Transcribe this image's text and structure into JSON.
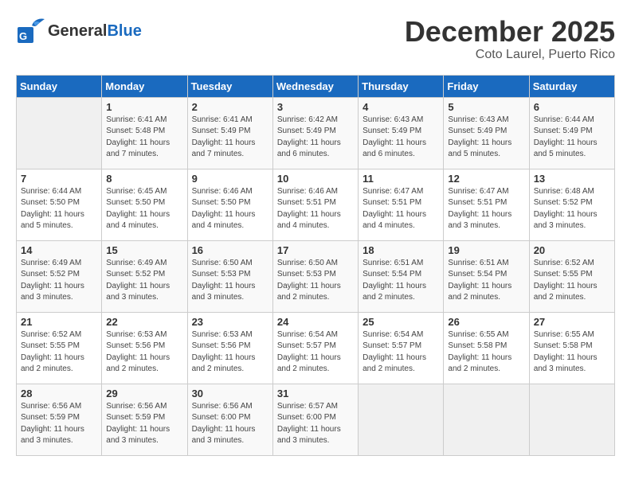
{
  "header": {
    "logo_general": "General",
    "logo_blue": "Blue",
    "month_title": "December 2025",
    "location": "Coto Laurel, Puerto Rico"
  },
  "days_of_week": [
    "Sunday",
    "Monday",
    "Tuesday",
    "Wednesday",
    "Thursday",
    "Friday",
    "Saturday"
  ],
  "weeks": [
    [
      {
        "day": "",
        "sunrise": "",
        "sunset": "",
        "daylight": ""
      },
      {
        "day": "1",
        "sunrise": "Sunrise: 6:41 AM",
        "sunset": "Sunset: 5:48 PM",
        "daylight": "Daylight: 11 hours and 7 minutes."
      },
      {
        "day": "2",
        "sunrise": "Sunrise: 6:41 AM",
        "sunset": "Sunset: 5:49 PM",
        "daylight": "Daylight: 11 hours and 7 minutes."
      },
      {
        "day": "3",
        "sunrise": "Sunrise: 6:42 AM",
        "sunset": "Sunset: 5:49 PM",
        "daylight": "Daylight: 11 hours and 6 minutes."
      },
      {
        "day": "4",
        "sunrise": "Sunrise: 6:43 AM",
        "sunset": "Sunset: 5:49 PM",
        "daylight": "Daylight: 11 hours and 6 minutes."
      },
      {
        "day": "5",
        "sunrise": "Sunrise: 6:43 AM",
        "sunset": "Sunset: 5:49 PM",
        "daylight": "Daylight: 11 hours and 5 minutes."
      },
      {
        "day": "6",
        "sunrise": "Sunrise: 6:44 AM",
        "sunset": "Sunset: 5:49 PM",
        "daylight": "Daylight: 11 hours and 5 minutes."
      }
    ],
    [
      {
        "day": "7",
        "sunrise": "Sunrise: 6:44 AM",
        "sunset": "Sunset: 5:50 PM",
        "daylight": "Daylight: 11 hours and 5 minutes."
      },
      {
        "day": "8",
        "sunrise": "Sunrise: 6:45 AM",
        "sunset": "Sunset: 5:50 PM",
        "daylight": "Daylight: 11 hours and 4 minutes."
      },
      {
        "day": "9",
        "sunrise": "Sunrise: 6:46 AM",
        "sunset": "Sunset: 5:50 PM",
        "daylight": "Daylight: 11 hours and 4 minutes."
      },
      {
        "day": "10",
        "sunrise": "Sunrise: 6:46 AM",
        "sunset": "Sunset: 5:51 PM",
        "daylight": "Daylight: 11 hours and 4 minutes."
      },
      {
        "day": "11",
        "sunrise": "Sunrise: 6:47 AM",
        "sunset": "Sunset: 5:51 PM",
        "daylight": "Daylight: 11 hours and 4 minutes."
      },
      {
        "day": "12",
        "sunrise": "Sunrise: 6:47 AM",
        "sunset": "Sunset: 5:51 PM",
        "daylight": "Daylight: 11 hours and 3 minutes."
      },
      {
        "day": "13",
        "sunrise": "Sunrise: 6:48 AM",
        "sunset": "Sunset: 5:52 PM",
        "daylight": "Daylight: 11 hours and 3 minutes."
      }
    ],
    [
      {
        "day": "14",
        "sunrise": "Sunrise: 6:49 AM",
        "sunset": "Sunset: 5:52 PM",
        "daylight": "Daylight: 11 hours and 3 minutes."
      },
      {
        "day": "15",
        "sunrise": "Sunrise: 6:49 AM",
        "sunset": "Sunset: 5:52 PM",
        "daylight": "Daylight: 11 hours and 3 minutes."
      },
      {
        "day": "16",
        "sunrise": "Sunrise: 6:50 AM",
        "sunset": "Sunset: 5:53 PM",
        "daylight": "Daylight: 11 hours and 3 minutes."
      },
      {
        "day": "17",
        "sunrise": "Sunrise: 6:50 AM",
        "sunset": "Sunset: 5:53 PM",
        "daylight": "Daylight: 11 hours and 2 minutes."
      },
      {
        "day": "18",
        "sunrise": "Sunrise: 6:51 AM",
        "sunset": "Sunset: 5:54 PM",
        "daylight": "Daylight: 11 hours and 2 minutes."
      },
      {
        "day": "19",
        "sunrise": "Sunrise: 6:51 AM",
        "sunset": "Sunset: 5:54 PM",
        "daylight": "Daylight: 11 hours and 2 minutes."
      },
      {
        "day": "20",
        "sunrise": "Sunrise: 6:52 AM",
        "sunset": "Sunset: 5:55 PM",
        "daylight": "Daylight: 11 hours and 2 minutes."
      }
    ],
    [
      {
        "day": "21",
        "sunrise": "Sunrise: 6:52 AM",
        "sunset": "Sunset: 5:55 PM",
        "daylight": "Daylight: 11 hours and 2 minutes."
      },
      {
        "day": "22",
        "sunrise": "Sunrise: 6:53 AM",
        "sunset": "Sunset: 5:56 PM",
        "daylight": "Daylight: 11 hours and 2 minutes."
      },
      {
        "day": "23",
        "sunrise": "Sunrise: 6:53 AM",
        "sunset": "Sunset: 5:56 PM",
        "daylight": "Daylight: 11 hours and 2 minutes."
      },
      {
        "day": "24",
        "sunrise": "Sunrise: 6:54 AM",
        "sunset": "Sunset: 5:57 PM",
        "daylight": "Daylight: 11 hours and 2 minutes."
      },
      {
        "day": "25",
        "sunrise": "Sunrise: 6:54 AM",
        "sunset": "Sunset: 5:57 PM",
        "daylight": "Daylight: 11 hours and 2 minutes."
      },
      {
        "day": "26",
        "sunrise": "Sunrise: 6:55 AM",
        "sunset": "Sunset: 5:58 PM",
        "daylight": "Daylight: 11 hours and 2 minutes."
      },
      {
        "day": "27",
        "sunrise": "Sunrise: 6:55 AM",
        "sunset": "Sunset: 5:58 PM",
        "daylight": "Daylight: 11 hours and 3 minutes."
      }
    ],
    [
      {
        "day": "28",
        "sunrise": "Sunrise: 6:56 AM",
        "sunset": "Sunset: 5:59 PM",
        "daylight": "Daylight: 11 hours and 3 minutes."
      },
      {
        "day": "29",
        "sunrise": "Sunrise: 6:56 AM",
        "sunset": "Sunset: 5:59 PM",
        "daylight": "Daylight: 11 hours and 3 minutes."
      },
      {
        "day": "30",
        "sunrise": "Sunrise: 6:56 AM",
        "sunset": "Sunset: 6:00 PM",
        "daylight": "Daylight: 11 hours and 3 minutes."
      },
      {
        "day": "31",
        "sunrise": "Sunrise: 6:57 AM",
        "sunset": "Sunset: 6:00 PM",
        "daylight": "Daylight: 11 hours and 3 minutes."
      },
      {
        "day": "",
        "sunrise": "",
        "sunset": "",
        "daylight": ""
      },
      {
        "day": "",
        "sunrise": "",
        "sunset": "",
        "daylight": ""
      },
      {
        "day": "",
        "sunrise": "",
        "sunset": "",
        "daylight": ""
      }
    ]
  ]
}
